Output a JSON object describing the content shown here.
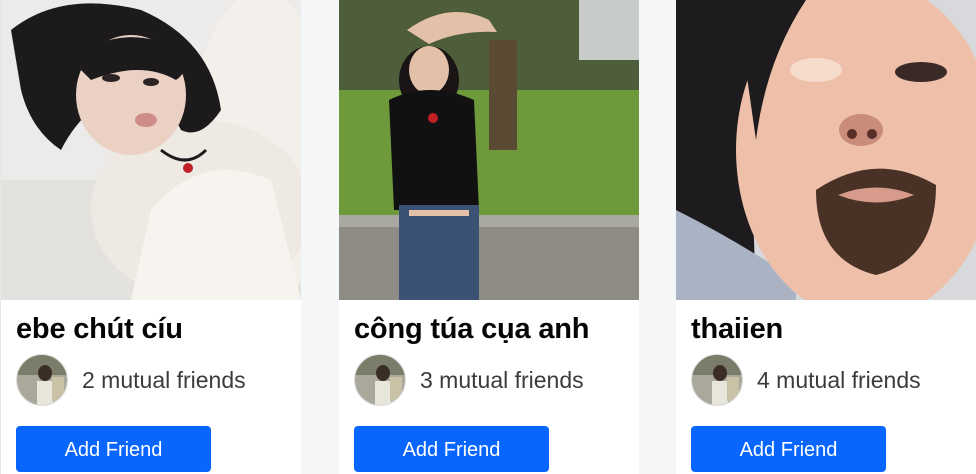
{
  "suggestions": [
    {
      "name": "ebe chút cíu",
      "mutual_friends": "2 mutual friends",
      "action_label": "Add Friend",
      "photo": "person-photo"
    },
    {
      "name": "công túa cụa anh",
      "mutual_friends": "3 mutual friends",
      "action_label": "Add Friend",
      "photo": "person-photo"
    },
    {
      "name": "thaiien",
      "mutual_friends": "4 mutual friends",
      "action_label": "Add Friend",
      "photo": "person-photo"
    }
  ],
  "colors": {
    "button": "#0866ff",
    "name_text": "#050505",
    "secondary_text": "#3a3b3c"
  }
}
